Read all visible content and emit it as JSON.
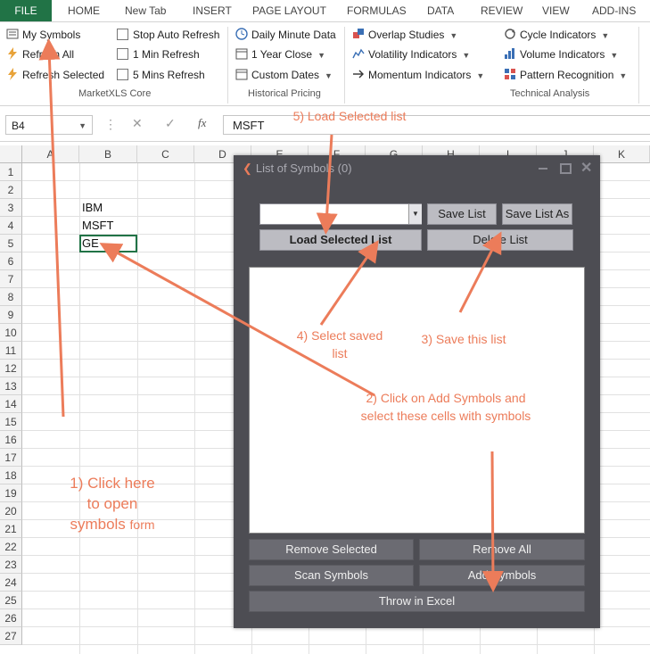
{
  "ribbon_tabs": [
    "FILE",
    "HOME",
    "New Tab",
    "INSERT",
    "PAGE LAYOUT",
    "FORMULAS",
    "DATA",
    "REVIEW",
    "VIEW",
    "ADD-INS"
  ],
  "marketxls_core": {
    "label": "MarketXLS Core",
    "my_symbols": "My Symbols",
    "refresh_all": "Refresh All",
    "refresh_selected": "Refresh Selected",
    "stop_auto_refresh": "Stop Auto Refresh",
    "min_refresh": "1 Min Refresh",
    "mins_refresh": "5 Mins Refresh"
  },
  "historical_pricing": {
    "label": "Historical Pricing",
    "daily_minute": "Daily Minute Data",
    "year_close": "1 Year Close",
    "custom_dates": "Custom Dates"
  },
  "technical_analysis": {
    "label": "Technical Analysis",
    "overlap": "Overlap Studies",
    "volatility": "Volatility Indicators",
    "momentum": "Momentum Indicators",
    "cycle": "Cycle Indicators",
    "volume": "Volume Indicators",
    "pattern": "Pattern Recognition"
  },
  "formula_bar": {
    "name_box": "B4",
    "cancel": "✕",
    "enter": "✓",
    "fx": "fx",
    "value": "MSFT"
  },
  "columns": [
    "A",
    "B",
    "C",
    "D",
    "E",
    "F",
    "G",
    "H",
    "I",
    "J",
    "K"
  ],
  "rows": [
    "1",
    "2",
    "3",
    "4",
    "5",
    "6",
    "7",
    "8",
    "9",
    "10",
    "11",
    "12",
    "13",
    "14",
    "15",
    "16",
    "17",
    "18",
    "19",
    "20",
    "21",
    "22",
    "23",
    "24",
    "25",
    "26",
    "27"
  ],
  "cells": {
    "B3": "IBM",
    "B4": "MSFT",
    "B5": "GE"
  },
  "dialog": {
    "title": "List of Symbols (0)",
    "save_list": "Save List",
    "save_list_as": "Save List As",
    "load_selected_list": "Load Selected List",
    "delete_list": "Delete List",
    "remove_selected": "Remove Selected",
    "remove_all": "Remove All",
    "scan_symbols": "Scan Symbols",
    "add_symbols": "Add Symbols",
    "throw_in_excel": "Throw in Excel"
  },
  "annotations": {
    "step1_a": "1) Click here",
    "step1_b": "to open",
    "step1_c": "symbols",
    "step1_d": "form",
    "step2_a": "2) Click on Add Symbols and",
    "step2_b": "select these cells with symbols",
    "step3": "3) Save this list",
    "step4_a": "4) Select saved",
    "step4_b": "list",
    "step5": "5) Load Selected list"
  },
  "colors": {
    "excel_green": "#217346",
    "annotation": "#ec7c5a",
    "dialog_bg": "#4d4d53"
  }
}
